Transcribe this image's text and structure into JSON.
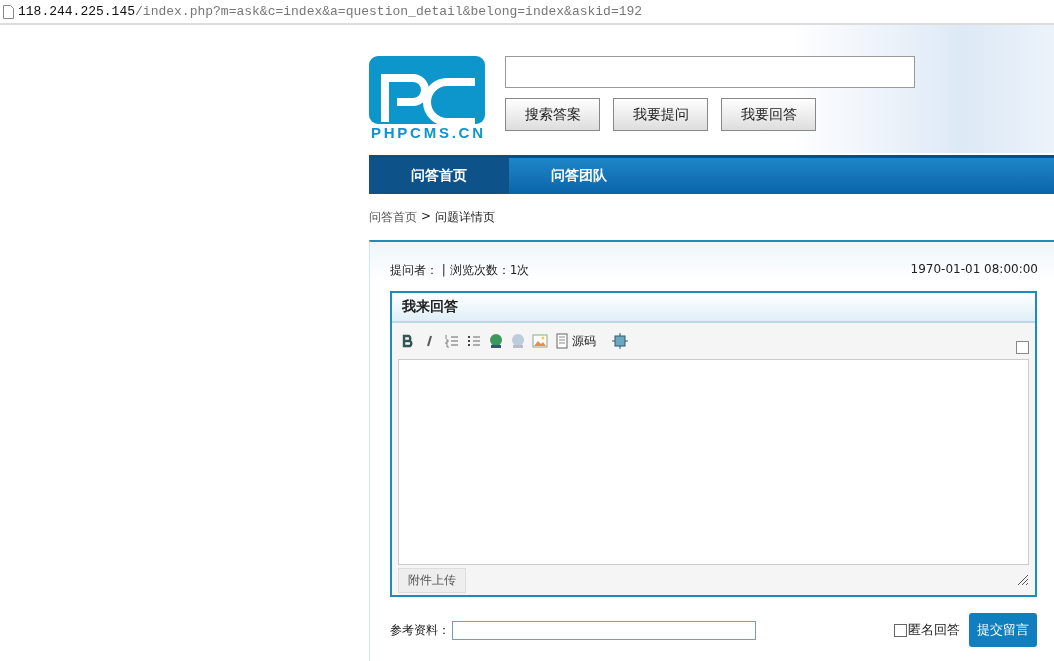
{
  "address_bar": {
    "host": "118.244.225.145",
    "path": "/index.php?m=ask&c=index&a=question_detail&belong=index&askid=192"
  },
  "header": {
    "logo_text": "PHPCMS.CN",
    "buttons": [
      "搜索答案",
      "我要提问",
      "我要回答"
    ]
  },
  "nav": [
    {
      "label": "问答首页",
      "selected": true
    },
    {
      "label": "问答团队",
      "selected": false
    }
  ],
  "breadcrumb": {
    "home": "问答首页",
    "separator": ">",
    "current": "问题详情页"
  },
  "question_info": {
    "meta": "提问者： | 浏览次数：1次",
    "time": "1970-01-01 08:00:00"
  },
  "answer_editor": {
    "title": "我来回答",
    "toolbar": [
      {
        "kind": "bold"
      },
      {
        "kind": "italic"
      },
      {
        "kind": "ordered-list"
      },
      {
        "kind": "bullet-list"
      },
      {
        "kind": "link"
      },
      {
        "kind": "unlink"
      },
      {
        "kind": "image"
      },
      {
        "kind": "source",
        "label": "源码"
      },
      {
        "kind": "maximize"
      }
    ],
    "attach_button": "附件上传"
  },
  "reference": {
    "label": "参考资料："
  },
  "anonymous": {
    "label": "匿名回答",
    "checked": false
  },
  "submit": "提交留言"
}
